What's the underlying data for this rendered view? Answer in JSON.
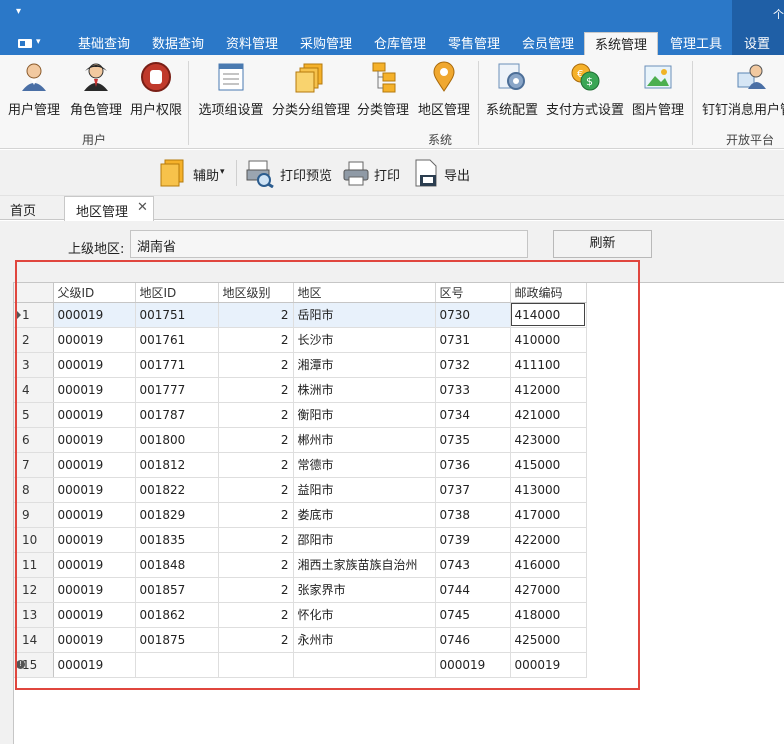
{
  "titlebar": {
    "quick_access": "▾",
    "corner": "个"
  },
  "tabs": [
    "基础查询",
    "数据查询",
    "资料管理",
    "采购管理",
    "仓库管理",
    "零售管理",
    "会员管理",
    "系统管理",
    "管理工具",
    "设置"
  ],
  "ribbon": {
    "buttons": [
      "用户管理",
      "角色管理",
      "用户权限",
      "选项组设置",
      "分类分组管理",
      "分类管理",
      "地区管理",
      "系统配置",
      "支付方式设置",
      "图片管理",
      "钉钉消息用户管"
    ],
    "groups": [
      "用户",
      "系统",
      "开放平台"
    ]
  },
  "toolbar": {
    "assist": "辅助",
    "assist_arrow": "▾",
    "print_preview": "打印预览",
    "print": "打印",
    "export": "导出"
  },
  "doc_tabs": {
    "home": "首页",
    "active": "地区管理",
    "close": "✕"
  },
  "form": {
    "parent_label": "上级地区:",
    "parent_value": "湖南省",
    "refresh": "刷新"
  },
  "grid": {
    "headers": [
      "父级ID",
      "地区ID",
      "地区级别",
      "地区",
      "区号",
      "邮政编码"
    ],
    "rows": [
      [
        "1",
        "000019",
        "001751",
        "2",
        "岳阳市",
        "0730",
        "414000"
      ],
      [
        "2",
        "000019",
        "001761",
        "2",
        "长沙市",
        "0731",
        "410000"
      ],
      [
        "3",
        "000019",
        "001771",
        "2",
        "湘潭市",
        "0732",
        "411100"
      ],
      [
        "4",
        "000019",
        "001777",
        "2",
        "株洲市",
        "0733",
        "412000"
      ],
      [
        "5",
        "000019",
        "001787",
        "2",
        "衡阳市",
        "0734",
        "421000"
      ],
      [
        "6",
        "000019",
        "001800",
        "2",
        "郴州市",
        "0735",
        "423000"
      ],
      [
        "7",
        "000019",
        "001812",
        "2",
        "常德市",
        "0736",
        "415000"
      ],
      [
        "8",
        "000019",
        "001822",
        "2",
        "益阳市",
        "0737",
        "413000"
      ],
      [
        "9",
        "000019",
        "001829",
        "2",
        "娄底市",
        "0738",
        "417000"
      ],
      [
        "10",
        "000019",
        "001835",
        "2",
        "邵阳市",
        "0739",
        "422000"
      ],
      [
        "11",
        "000019",
        "001848",
        "2",
        "湘西土家族苗族自治州",
        "0743",
        "416000"
      ],
      [
        "12",
        "000019",
        "001857",
        "2",
        "张家界市",
        "0744",
        "427000"
      ],
      [
        "13",
        "000019",
        "001862",
        "2",
        "怀化市",
        "0745",
        "418000"
      ],
      [
        "14",
        "000019",
        "001875",
        "2",
        "永州市",
        "0746",
        "425000"
      ],
      [
        "15",
        "000019",
        "",
        "",
        "",
        "000019",
        "000019"
      ]
    ]
  }
}
